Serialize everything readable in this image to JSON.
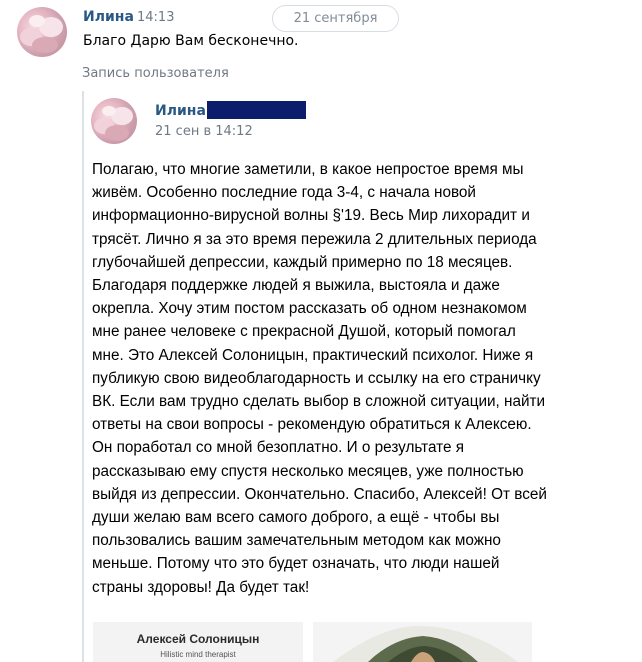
{
  "message": {
    "author": "Илина",
    "time": "14:13",
    "text": "Благо Дарю Вам бесконечно."
  },
  "date_divider": "21 сентября",
  "repost": {
    "label": "Запись пользователя",
    "author": "Илина",
    "date": "21 сен в 14:12",
    "body_lines": [
      "Полагаю, что многие заметили, в какое непростое время мы",
      "живём. Особенно последние года 3-4, с начала новой",
      "информационно-вирусной волны §'19. Весь Мир лихорадит и",
      "трясёт. Лично я за это время пережила 2 длительных периода",
      "глубочайшей депрессии, каждый примерно по 18 месяцев.",
      "Благодаря поддержке людей я выжила, выстояла и даже",
      "окрепла. Хочу этим постом рассказать об одном незнакомом",
      "мне ранее человеке с прекрасной Душой, который помогал",
      "мне. Это Алексей Солоницын, практический психолог. Ниже я",
      "публикую свою видеоблагодарность и ссылку на его страничку",
      "ВК. Если вам трудно сделать выбор в сложной ситуации, найти",
      "ответы на свои вопросы - рекомендую обратиться к Алексею.",
      "Он поработал со мной безоплатно. И о результате я",
      "рассказываю ему спустя несколько месяцев, уже полностью",
      "выйдя из депрессии. Окончательно. Спасибо, Алексей! От всей",
      "души желаю вам всего самого доброго, а ещё - чтобы вы",
      "пользовались вашим замечательным методом как можно",
      "меньше. Потому что это будет означать, что люди нашей",
      "страны здоровы! Да будет так!"
    ],
    "attachment": {
      "name": "Алексей Солоницын",
      "role": "Hilistic mind therapist"
    }
  },
  "colors": {
    "link": "#2a5885",
    "secondary_text": "#6f7985",
    "redaction": "#0c1e6b"
  },
  "icons": {
    "message_avatar": "avatar-photo",
    "post_avatar": "avatar-photo"
  }
}
